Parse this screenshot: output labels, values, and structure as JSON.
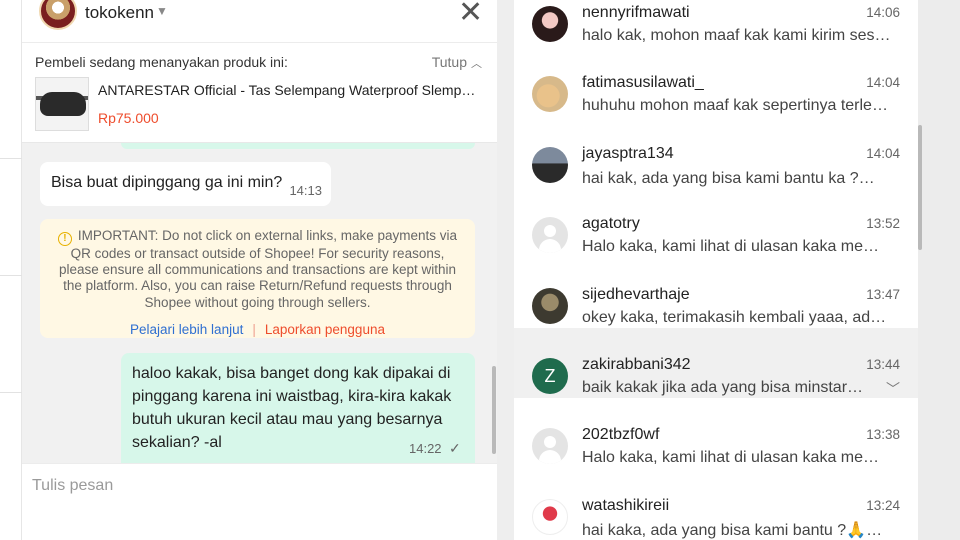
{
  "header": {
    "shop_name": "tokokenn",
    "chevron_icon": "chevron-down-icon",
    "close_icon": "close-icon",
    "close_glyph": "✕"
  },
  "product_card": {
    "title": "Pembeli sedang menanyakan produk ini:",
    "close_label": "Tutup",
    "product_name": "ANTARESTAR Official - Tas Selempang Waterproof Slempang Pinggang Waist Bag",
    "price": "Rp75.000"
  },
  "messages": {
    "incoming": {
      "text": "Bisa buat dipinggang ga ini min?",
      "time": "14:13"
    },
    "warning": {
      "icon": "info-icon",
      "text": "IMPORTANT: Do not click on external links, make payments via QR codes or transact outside of Shopee! For security reasons, please ensure all communications and transactions are kept within the platform. Also, you can raise Return/Refund requests through Shopee without going through sellers.",
      "learn_more": "Pelajari lebih lanjut",
      "report": "Laporkan pengguna"
    },
    "outgoing": {
      "text": "haloo kakak, bisa banget dong kak dipakai di pinggang karena ini waistbag, kira-kira kakak butuh ukuran kecil atau mau yang besarnya sekalian? -al",
      "time": "14:22",
      "status_icon": "check-icon"
    }
  },
  "composer": {
    "placeholder": "Tulis pesan"
  },
  "conversations": [
    {
      "name": "nennyrifmawati",
      "time": "14:06",
      "preview": "halo kak, mohon maaf kak kami kirim sesuai pesanan ya kak",
      "avatar": "photo"
    },
    {
      "name": "fatimasusilawati_",
      "time": "14:04",
      "preview": "huhuhu mohon maaf kak sepertinya terlewat ya kak",
      "avatar": "photo"
    },
    {
      "name": "jayasptra134",
      "time": "14:04",
      "preview": "hai kak, ada yang bisa kami bantu ka ?🥰 ada yang bisa",
      "avatar": "photo"
    },
    {
      "name": "agatotry",
      "time": "13:52",
      "preview": "Halo kaka, kami lihat di ulasan kaka memberikan",
      "avatar": "default"
    },
    {
      "name": "sijedhevarthaje",
      "time": "13:47",
      "preview": "okey kaka, terimakasih kembali yaaa, ada yang bisa",
      "avatar": "photo"
    },
    {
      "name": "zakirabbani342",
      "time": "13:44",
      "preview": "baik kakak jika ada yang bisa minstar bantu",
      "avatar": "letter",
      "letter": "Z",
      "active": true
    },
    {
      "name": "202tbzf0wf",
      "time": "13:38",
      "preview": "Halo kaka, kami lihat di ulasan kaka memberikan",
      "avatar": "default"
    },
    {
      "name": "watashikireii",
      "time": "13:24",
      "preview": "hai kaka, ada yang bisa kami bantu ?🙏🥰 ada yang bisa",
      "avatar": "logo"
    }
  ]
}
